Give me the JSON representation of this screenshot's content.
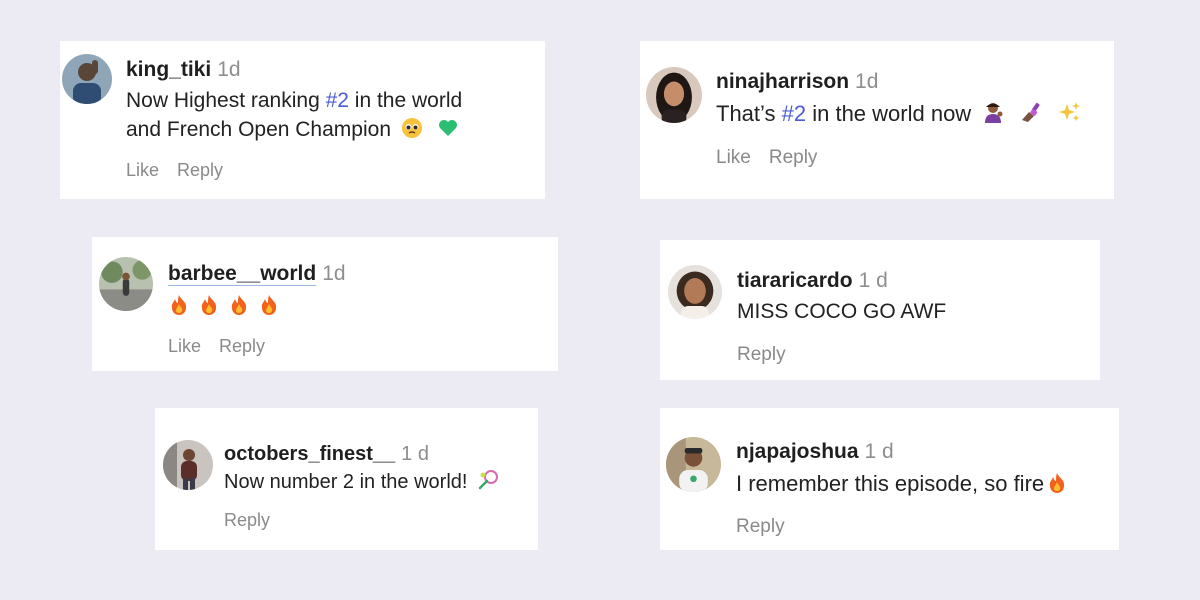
{
  "comments": [
    {
      "username": "king_tiki",
      "time": "1d",
      "line1_pre": "Now Highest ranking ",
      "line1_tag": "#2",
      "line1_post": " in the world",
      "line2": "and French Open Champion",
      "emojis": [
        "pleading-face-emoji",
        "green-heart-emoji"
      ],
      "actions": [
        "Like",
        "Reply"
      ]
    },
    {
      "username": "ninajharrison",
      "time": "1d",
      "line1_pre": "That’s ",
      "line1_tag": "#2",
      "line1_post": " in the world now",
      "emojis": [
        "person-tipping-hand-emoji",
        "nail-polish-emoji",
        "sparkles-emoji"
      ],
      "actions": [
        "Like",
        "Reply"
      ]
    },
    {
      "username": "barbee__world",
      "time": "1d",
      "emojis": [
        "fire-emoji",
        "fire-emoji",
        "fire-emoji",
        "fire-emoji"
      ],
      "actions": [
        "Like",
        "Reply"
      ]
    },
    {
      "username": "tiararicardo",
      "time": "1 d",
      "text": "MISS COCO GO AWF",
      "actions": [
        "Reply"
      ]
    },
    {
      "username": "octobers_finest__",
      "time": "1 d",
      "text": "Now number 2 in the world!",
      "emojis": [
        "tennis-racket-emoji"
      ],
      "actions": [
        "Reply"
      ]
    },
    {
      "username": "njapajoshua",
      "time": "1 d",
      "text": "I remember this episode, so fire",
      "emojis": [
        "fire-emoji"
      ],
      "actions": [
        "Reply"
      ]
    }
  ],
  "colors": {
    "background": "#ecebf4",
    "card": "#ffffff",
    "hashtag": "#4a5bd4",
    "meta": "#8e8e8e"
  }
}
